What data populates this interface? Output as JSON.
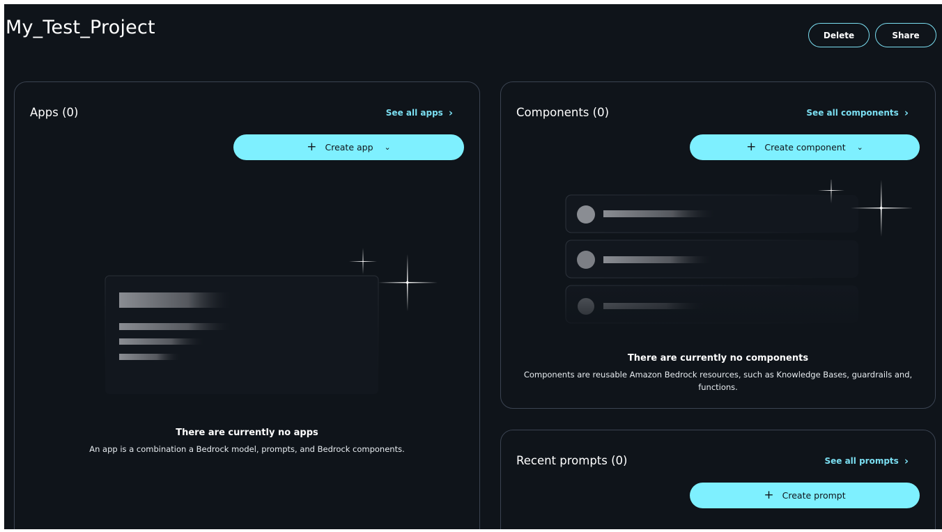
{
  "header": {
    "title": "My_Test_Project",
    "delete_label": "Delete",
    "share_label": "Share"
  },
  "apps": {
    "title": "Apps (0)",
    "see_all": "See all apps",
    "create_label": "Create app",
    "empty_title": "There are currently no apps",
    "empty_desc": "An app is a combination a Bedrock model, prompts, and Bedrock components."
  },
  "components": {
    "title": "Components (0)",
    "see_all": "See all components",
    "create_label": "Create component",
    "empty_title": "There are currently no components",
    "empty_desc": "Components are reusable Amazon Bedrock resources, such as Knowledge Bases, guardrails and, functions."
  },
  "prompts": {
    "title": "Recent prompts (0)",
    "see_all": "See all prompts",
    "create_label": "Create prompt"
  },
  "theme": {
    "accent": "#7ef0ff",
    "link": "#7bdff2",
    "background": "#0f141a",
    "border": "#3b4452"
  }
}
